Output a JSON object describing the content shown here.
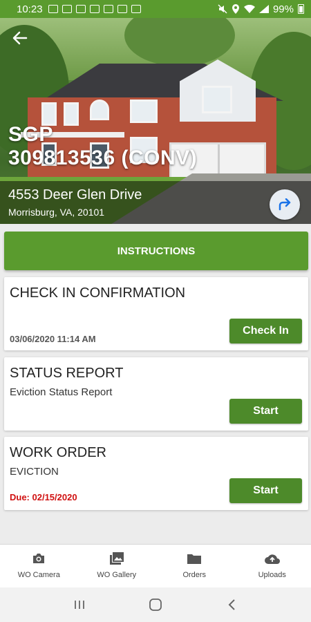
{
  "status_bar": {
    "time": "10:23",
    "battery": "99%"
  },
  "header": {
    "back_icon": "arrow-left-icon",
    "title_line1": "SGP",
    "title_line2": "309813536 (CONV)",
    "address": "4553 Deer Glen Drive",
    "city": "Morrisburg, VA, 20101",
    "nav_icon": "navigate-icon"
  },
  "instructions_label": "INSTRUCTIONS",
  "cards": [
    {
      "title": "CHECK IN CONFIRMATION",
      "subtitle": "",
      "meta": "03/06/2020 11:14 AM",
      "button": "Check In"
    },
    {
      "title": "STATUS REPORT",
      "subtitle": "Eviction Status Report",
      "button": "Start"
    },
    {
      "title": "WORK ORDER",
      "subtitle": "EVICTION",
      "due": "Due: 02/15/2020",
      "button": "Start"
    }
  ],
  "bottom_nav": [
    {
      "label": "WO Camera",
      "icon": "camera-icon"
    },
    {
      "label": "WO Gallery",
      "icon": "gallery-icon"
    },
    {
      "label": "Orders",
      "icon": "folder-icon"
    },
    {
      "label": "Uploads",
      "icon": "cloud-upload-icon"
    }
  ],
  "colors": {
    "primary_green": "#5a9b2e",
    "button_green": "#4d8a2a",
    "due_red": "#d01010"
  }
}
